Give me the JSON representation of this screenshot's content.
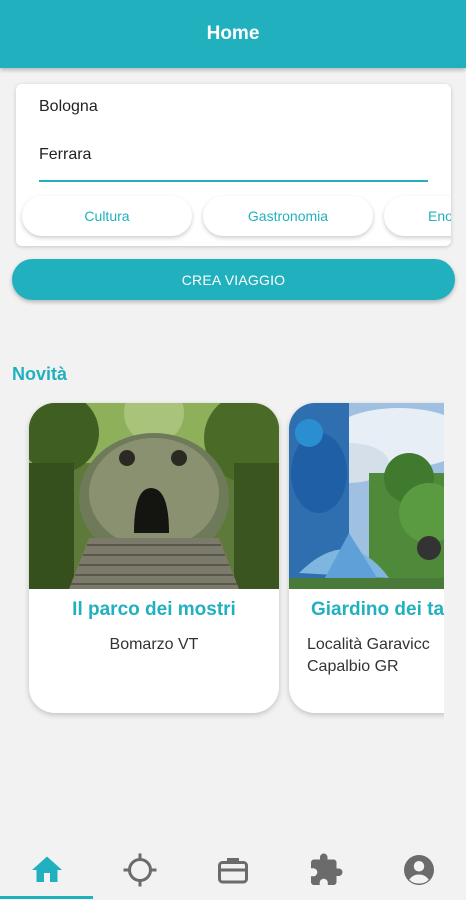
{
  "header": {
    "title": "Home"
  },
  "search": {
    "from": "Bologna",
    "to": "Ferrara",
    "chips": [
      "Cultura",
      "Gastronomia",
      "Eno"
    ]
  },
  "create_button": "CREA VIAGGIO",
  "section": {
    "title": "Novità"
  },
  "places": [
    {
      "name": "Il parco dei mostri",
      "location_line1": "Bomarzo VT",
      "location_line2": ""
    },
    {
      "name": "Giardino dei ta",
      "location_line1": "Località Garavicc",
      "location_line2": "Capalbio GR"
    }
  ],
  "nav": {
    "items": [
      "home-icon",
      "gps-icon",
      "briefcase-icon",
      "puzzle-icon",
      "account-icon"
    ],
    "active": "home-icon"
  },
  "colors": {
    "accent": "#21b1be",
    "inactive_icon": "#6b6b6b",
    "background": "#f2f2f2"
  }
}
